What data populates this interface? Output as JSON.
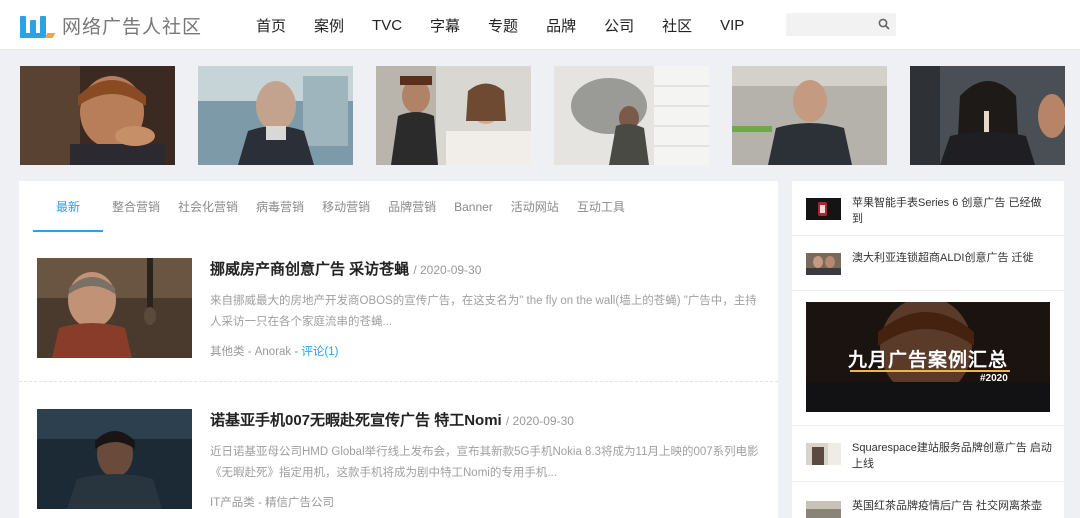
{
  "header": {
    "logo_text": "网络广告人社区",
    "nav": [
      "首页",
      "案例",
      "TVC",
      "字幕",
      "专题",
      "品牌",
      "公司",
      "社区",
      "VIP"
    ],
    "search": {
      "value": "",
      "placeholder": ""
    }
  },
  "thumb_strip": {
    "items": [
      "thumb-1",
      "thumb-2",
      "thumb-3",
      "thumb-4",
      "thumb-5",
      "thumb-6"
    ]
  },
  "tabs": [
    "最新",
    "整合营销",
    "社会化营销",
    "病毒营销",
    "移动营销",
    "品牌营销",
    "Banner",
    "活动网站",
    "互动工具"
  ],
  "articles": [
    {
      "title": "挪威房产商创意广告 采访苍蝇",
      "date": "/ 2020-09-30",
      "summary": "来自挪威最大的房地产开发商OBOS的宣传广告，在这支名为\" the fly on the wall(墙上的苍蝇) \"广告中，主持人采访一只在各个家庭流串的苍蝇...",
      "category": "其他类",
      "author": "- Anorak",
      "comments": "- 评论(1)"
    },
    {
      "title": "诺基亚手机007无暇赴死宣传广告 特工Nomi",
      "date": "/ 2020-09-30",
      "summary": "近日诺基亚母公司HMD Global举行线上发布会，宣布其新款5G手机Nokia 8.3将成为11月上映的007系列电影《无暇赴死》指定用机，这款手机将成为剧中特工Nomi的专用手机...",
      "category": "IT产品类",
      "author": "- 精信广告公司",
      "comments": ""
    }
  ],
  "sidebar": {
    "items": [
      "苹果智能手表Series 6 创意广告 已经做到",
      "澳大利亚连锁超商ALDI创意广告 迁徙",
      "Squarespace建站服务品牌创意广告 启动上线",
      "英国红茶品牌疫情后广告 社交网离茶壶"
    ],
    "banner_title": "九月广告案例汇总",
    "banner_tag": "#2020"
  },
  "colors": {
    "accent": "#2aa2e5",
    "logo_orange": "#f2a43c",
    "banner_line": "#f0b54a"
  }
}
